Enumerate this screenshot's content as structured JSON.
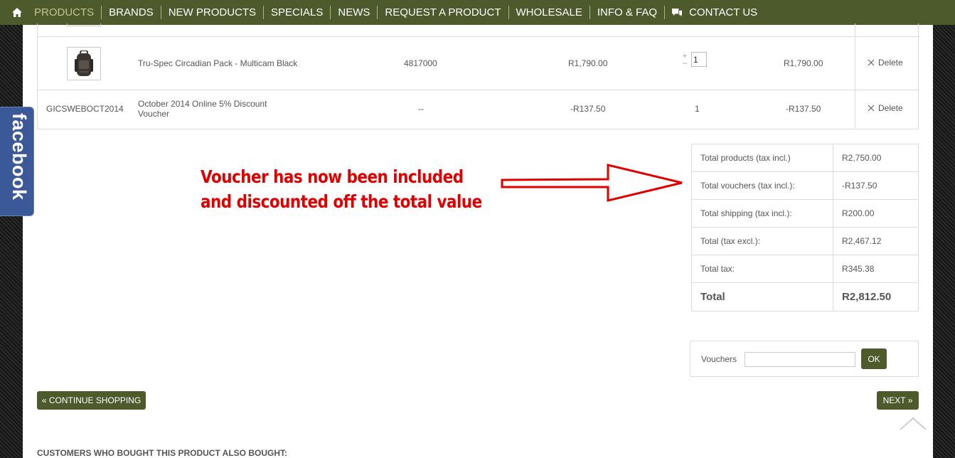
{
  "nav": {
    "items": [
      "PRODUCTS",
      "BRANDS",
      "NEW PRODUCTS",
      "SPECIALS",
      "NEWS",
      "REQUEST A PRODUCT",
      "WHOLESALE",
      "INFO & FAQ"
    ],
    "contact": "CONTACT US",
    "active_color": "#c2c78e",
    "bar_color": "#4d5a2c"
  },
  "cart": {
    "rows": [
      {
        "ref": "",
        "product": "Tru-Spec Circadian Pack - Multicam Black",
        "code": "4817000",
        "unit_price": "R1,790.00",
        "qty": "1",
        "total": "R1,790.00",
        "delete_label": "Delete"
      },
      {
        "ref": "GICSWEBOCT2014",
        "product_line1": "October 2014 Online 5% Discount",
        "product_line2": "Voucher",
        "code": "--",
        "unit_price": "-R137.50",
        "qty": "1",
        "total": "-R137.50",
        "delete_label": "Delete"
      }
    ],
    "qty_plus": "+",
    "qty_minus": "–"
  },
  "annotation": {
    "line1": "Voucher has now been included",
    "line2": "and discounted off the total value",
    "color": "#e00000"
  },
  "totals": [
    {
      "label": "Total products (tax incl.)",
      "value": "R2,750.00"
    },
    {
      "label": "Total vouchers (tax incl.):",
      "value": "-R137.50"
    },
    {
      "label": "Total shipping (tax incl.):",
      "value": "R200.00"
    },
    {
      "label": "Total (tax excl.):",
      "value": "R2,467.12"
    },
    {
      "label": "Total tax:",
      "value": "R345.38"
    },
    {
      "label": "Total",
      "value": "R2,812.50"
    }
  ],
  "voucher": {
    "label": "Vouchers",
    "value": "",
    "ok_label": "OK"
  },
  "buttons": {
    "continue_label": "« CONTINUE SHOPPING",
    "next_label": "NEXT »"
  },
  "also_bought": "CUSTOMERS WHO BOUGHT THIS PRODUCT ALSO BOUGHT:",
  "facebook_label": "facebook"
}
